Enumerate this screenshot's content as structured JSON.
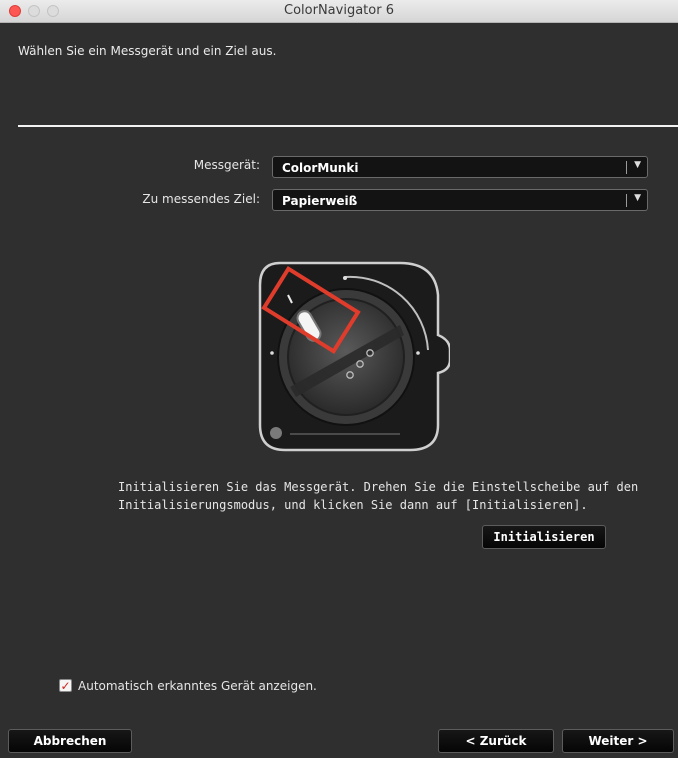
{
  "window": {
    "title": "ColorNavigator 6"
  },
  "header": {
    "instruction": "Wählen Sie ein Messgerät und ein Ziel aus."
  },
  "form": {
    "device_label": "Messgerät:",
    "device_value": "ColorMunki",
    "target_label": "Zu messendes Ziel:",
    "target_value": "Papierweiß"
  },
  "illustration": {
    "icon": "colormunki-dial-icon",
    "highlight_color": "#e03c2c"
  },
  "instruction": {
    "line1": "Initialisieren Sie das Messgerät. Drehen Sie die Einstellscheibe auf den",
    "line2": "Initialisierungsmodus, und klicken Sie dann auf [Initialisieren].",
    "button": "Initialisieren"
  },
  "options": {
    "auto_detect_label": "Automatisch erkanntes Gerät anzeigen.",
    "auto_detect_checked": true
  },
  "footer": {
    "cancel": "Abbrechen",
    "back": "< Zurück",
    "next": "Weiter >"
  }
}
